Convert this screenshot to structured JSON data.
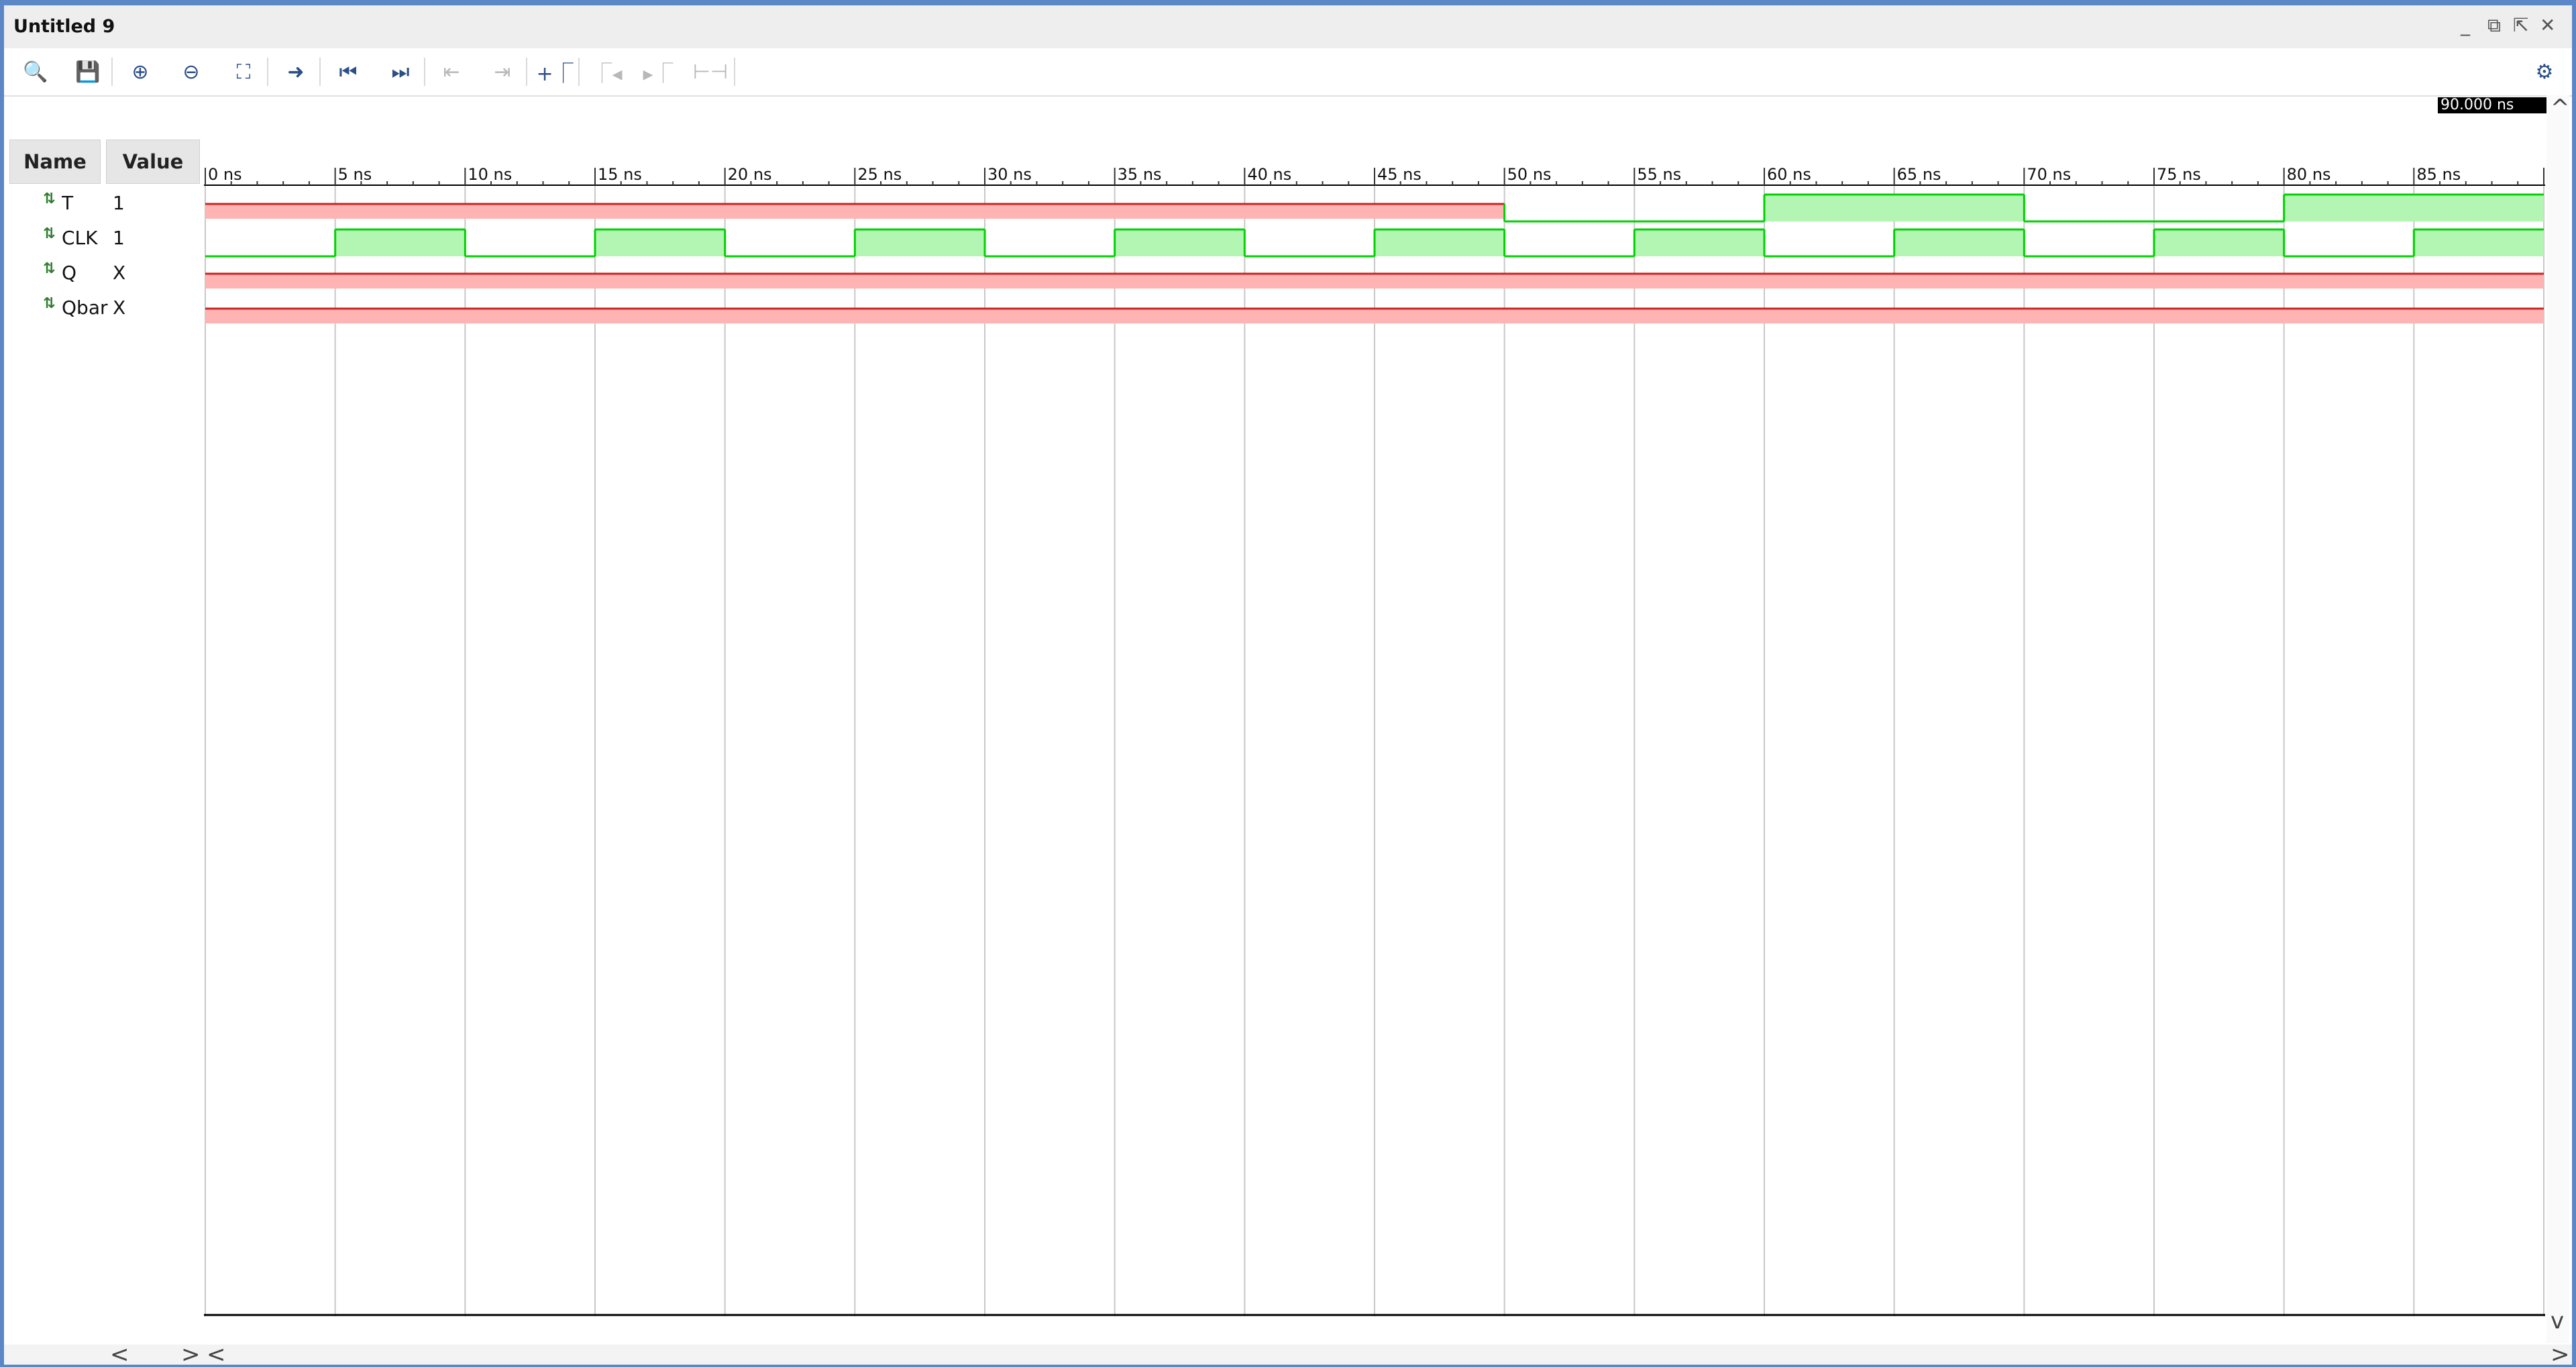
{
  "window": {
    "title": "Untitled 9",
    "controls": {
      "minimize": "_",
      "restore": "⧉",
      "float": "⇱",
      "close": "✕"
    }
  },
  "toolbar": {
    "buttons": [
      {
        "name": "search-icon",
        "glyph": "🔍",
        "enabled": true
      },
      {
        "name": "save-icon",
        "glyph": "💾",
        "enabled": true
      },
      {
        "name": "zoom-in-icon",
        "glyph": "⊕",
        "enabled": true
      },
      {
        "name": "zoom-out-icon",
        "glyph": "⊖",
        "enabled": true
      },
      {
        "name": "zoom-fit-icon",
        "glyph": "⛶",
        "enabled": true
      },
      {
        "name": "go-to-cursor-icon",
        "glyph": "➜",
        "enabled": true
      },
      {
        "name": "go-to-time-zero-icon",
        "glyph": "⏮",
        "enabled": true
      },
      {
        "name": "go-to-last-time-icon",
        "glyph": "⏭",
        "enabled": true
      },
      {
        "name": "previous-transition-icon",
        "glyph": "⇤",
        "enabled": false
      },
      {
        "name": "next-transition-icon",
        "glyph": "⇥",
        "enabled": false
      },
      {
        "name": "add-marker-icon",
        "glyph": "+⎾",
        "enabled": true
      },
      {
        "name": "previous-marker-icon",
        "glyph": "⎾◂",
        "enabled": false
      },
      {
        "name": "next-marker-icon",
        "glyph": "▸⎾",
        "enabled": false
      },
      {
        "name": "swap-cursors-icon",
        "glyph": "⊢⊣",
        "enabled": false
      }
    ],
    "settings_icon": "⚙"
  },
  "columns": {
    "name": "Name",
    "value": "Value"
  },
  "signals": [
    {
      "name": "T",
      "value": "1"
    },
    {
      "name": "CLK",
      "value": "1"
    },
    {
      "name": "Q",
      "value": "X"
    },
    {
      "name": "Qbar",
      "value": "X"
    }
  ],
  "cursor_readout": "90.000 ns",
  "timeline": {
    "unit": "ns",
    "start": 0,
    "end": 90,
    "major_step": 5,
    "labels": [
      "0 ns",
      "5 ns",
      "10 ns",
      "15 ns",
      "20 ns",
      "25 ns",
      "30 ns",
      "35 ns",
      "40 ns",
      "45 ns",
      "50 ns",
      "55 ns",
      "60 ns",
      "65 ns",
      "70 ns",
      "75 ns",
      "80 ns",
      "85 ns"
    ]
  },
  "waveforms": {
    "T": [
      {
        "from": 0,
        "to": 50,
        "state": "X"
      },
      {
        "from": 50,
        "to": 60,
        "state": "0"
      },
      {
        "from": 60,
        "to": 70,
        "state": "1"
      },
      {
        "from": 70,
        "to": 80,
        "state": "0"
      },
      {
        "from": 80,
        "to": 90,
        "state": "1"
      }
    ],
    "CLK": [
      {
        "from": 0,
        "to": 5,
        "state": "0"
      },
      {
        "from": 5,
        "to": 10,
        "state": "1"
      },
      {
        "from": 10,
        "to": 15,
        "state": "0"
      },
      {
        "from": 15,
        "to": 20,
        "state": "1"
      },
      {
        "from": 20,
        "to": 25,
        "state": "0"
      },
      {
        "from": 25,
        "to": 30,
        "state": "1"
      },
      {
        "from": 30,
        "to": 35,
        "state": "0"
      },
      {
        "from": 35,
        "to": 40,
        "state": "1"
      },
      {
        "from": 40,
        "to": 45,
        "state": "0"
      },
      {
        "from": 45,
        "to": 50,
        "state": "1"
      },
      {
        "from": 50,
        "to": 55,
        "state": "0"
      },
      {
        "from": 55,
        "to": 60,
        "state": "1"
      },
      {
        "from": 60,
        "to": 65,
        "state": "0"
      },
      {
        "from": 65,
        "to": 70,
        "state": "1"
      },
      {
        "from": 70,
        "to": 75,
        "state": "0"
      },
      {
        "from": 75,
        "to": 80,
        "state": "1"
      },
      {
        "from": 80,
        "to": 85,
        "state": "0"
      },
      {
        "from": 85,
        "to": 90,
        "state": "1"
      }
    ],
    "Q": [
      {
        "from": 0,
        "to": 90,
        "state": "X"
      }
    ],
    "Qbar": [
      {
        "from": 0,
        "to": 90,
        "state": "X"
      }
    ]
  },
  "colors": {
    "title_border": "#5b87c7",
    "wave_high_fill": "#b3f5b3",
    "wave_line": "#00d200",
    "wave_x_fill": "#ffb3b3",
    "wave_x_line": "#cc2222",
    "grid": "#c8c8c8",
    "icon": "#2b4f86",
    "icon_disabled": "#b8b8b8"
  },
  "scroll": {
    "left": "<",
    "right": ">",
    "up": "^",
    "down": "v"
  }
}
